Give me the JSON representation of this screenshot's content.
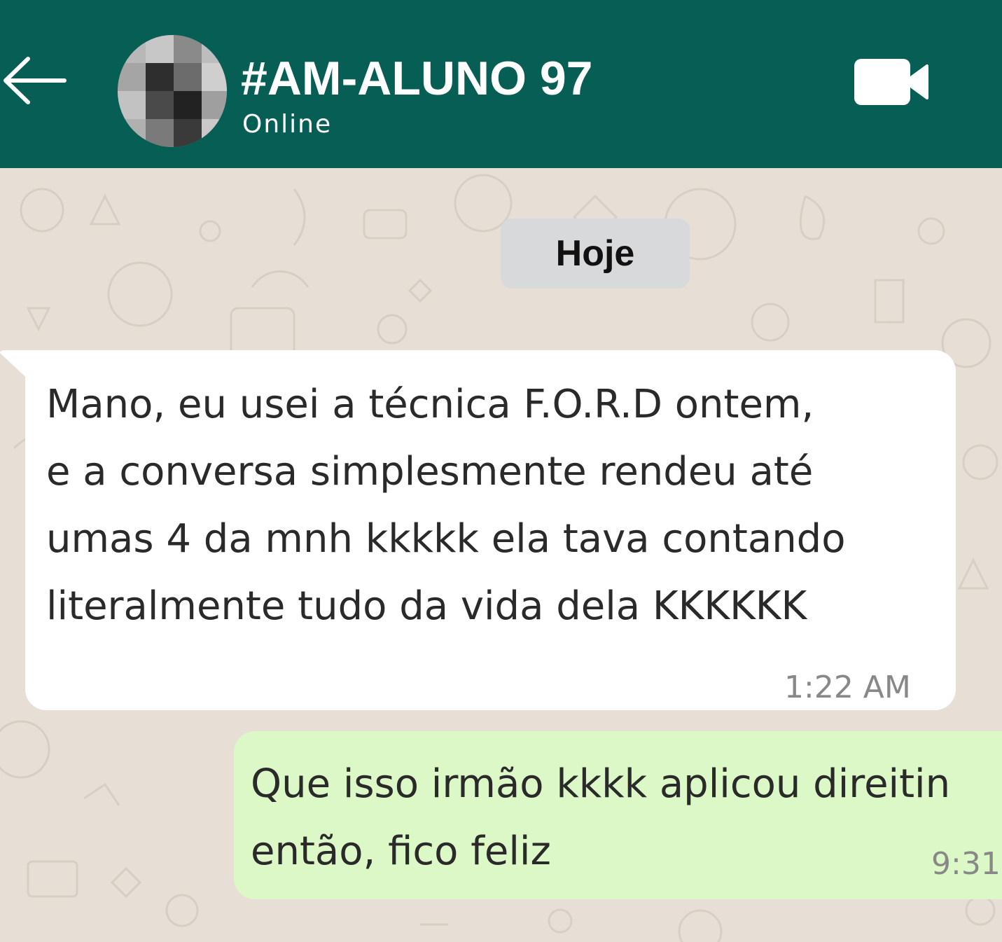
{
  "header": {
    "title": "#AM-ALUNO 97",
    "status": "Online",
    "back_icon": "arrow-left-icon",
    "video_icon": "video-call-icon",
    "avatar": "blurred-contact-photo"
  },
  "colors": {
    "header_bg": "#075e55",
    "chat_bg": "#e7dfd6",
    "incoming_bubble": "#ffffff",
    "outgoing_bubble": "#dcf8c6",
    "date_chip": "#d8d9db"
  },
  "chat": {
    "date_label": "Hoje",
    "messages": [
      {
        "direction": "incoming",
        "lines": [
          "Mano, eu usei a técnica F.O.R.D ontem,",
          "e a conversa simplesmente rendeu até",
          "umas 4 da mnh kkkkk ela tava contando",
          "literalmente tudo da vida dela KKKKKK"
        ],
        "time": "1:22 AM"
      },
      {
        "direction": "outgoing",
        "lines": [
          "Que isso irmão kkkk aplicou direitin",
          "então, fico feliz"
        ],
        "time": "9:31"
      }
    ]
  }
}
